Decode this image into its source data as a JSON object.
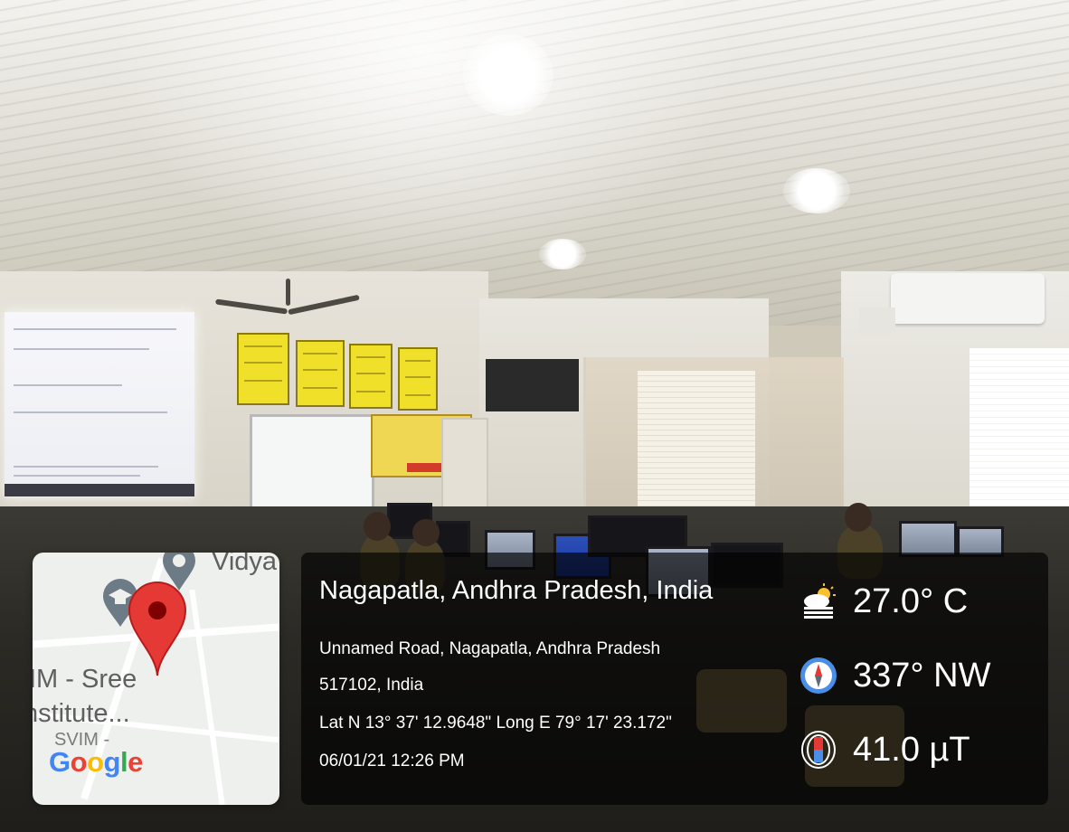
{
  "map": {
    "label_top": "Vidya",
    "label_line1": "IM - Sree",
    "label_line2": "nstitute...",
    "label_line3": "SVIM -",
    "logo_letters": [
      "G",
      "o",
      "o",
      "g",
      "l",
      "e"
    ],
    "logo_colors": [
      "#4285F4",
      "#EA4335",
      "#FBBC05",
      "#4285F4",
      "#34A853",
      "#EA4335"
    ],
    "pin_color": "#E53935",
    "icons": [
      "location-pin-icon",
      "place-pin-icon",
      "school-icon"
    ]
  },
  "location": {
    "title": "Nagapatla, Andhra Pradesh, India",
    "address_line1": "Unnamed Road, Nagapatla, Andhra Pradesh",
    "address_line2": "517102, India",
    "coordinates": "Lat N 13° 37' 12.9648\" Long E 79° 17' 23.172\"",
    "datetime": "06/01/21 12:26 PM"
  },
  "metrics": {
    "temperature": "27.0° C",
    "direction": "337° NW",
    "magnetic": "41.0 µT",
    "icons": [
      "weather-sun-cloud-icon",
      "compass-icon",
      "magnet-icon"
    ]
  }
}
